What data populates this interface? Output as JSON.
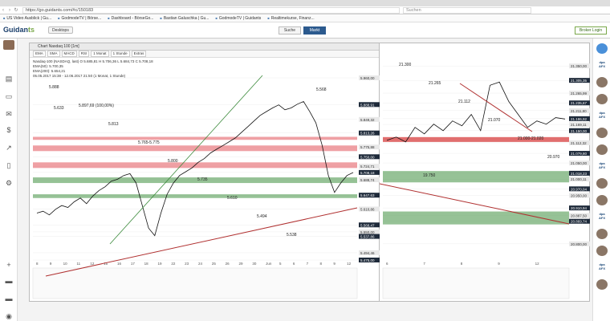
{
  "browser": {
    "url": "https://go.guidants.com/#c/150183",
    "search_placeholder": "Suchen",
    "bookmarks": [
      "US Video Ausblick | Gu...",
      "GodmodeTV | Börse...",
      "Dashboard - BörseGo...",
      "Bastian Galuschka | Gu...",
      "GodmodeTV | Guidants",
      "Realtimekurse, Finanz..."
    ]
  },
  "header": {
    "logo_a": "Guidan",
    "logo_b": "ts",
    "desktops_label": "Desktops",
    "suche_label": "Suche",
    "markt_label": "Markt",
    "login_label": "Broker Login"
  },
  "chart_main": {
    "title": "Chart Nasdaq 100 [1m]",
    "toolbar": [
      "EMA",
      "SMA",
      "MACD",
      "RSI",
      "1 Monat",
      "1 Stunde",
      "Extras"
    ],
    "legend": [
      "Nasdaq-100 (NASDAQ, last)  O 5.685,81  H 5.706,36  L 5.684,73  C 5.708,18",
      "EMA(50): 5.700,35",
      "EMA(200): 5.654,21",
      "05.05.2017 15:38 - 12.06.2017 21:50 (1 Monat, 1 Stunde)"
    ]
  },
  "chart_data": [
    {
      "type": "line",
      "title": "Nasdaq 100",
      "xlabel": "",
      "ylabel": "",
      "ylim": [
        5475,
        5975
      ],
      "y_ticks": [
        "5.960,00",
        "5.888,91",
        "5.849,32",
        "5.813,26",
        "5.775,88",
        "5.750,00",
        "5.724,71",
        "5.708,18",
        "5.688,74",
        "5.647,63",
        "5.610,86",
        "5.568,47",
        "5.550,00",
        "5.537,86",
        "5.494,46",
        "5.475,00"
      ],
      "x_ticks": [
        "8",
        "9",
        "10",
        "11",
        "12",
        "15",
        "16",
        "17",
        "18",
        "19",
        "22",
        "23",
        "24",
        "25",
        "26",
        "29",
        "30",
        "Jun",
        "5",
        "6",
        "7",
        "8",
        "9",
        "12"
      ],
      "annotations": [
        "5.888",
        "5.897,69 (100,00%)",
        "5.813",
        "5.765-5.775",
        "5.800",
        "5.735",
        "5.610",
        "5.494",
        "5.538",
        "5.568",
        "5.633"
      ],
      "series": [
        {
          "values": [
            5600,
            5605,
            5595,
            5610,
            5620,
            5615,
            5630,
            5640,
            5625,
            5645,
            5660,
            5670,
            5685,
            5690,
            5700,
            5705,
            5680,
            5620,
            5560,
            5540,
            5600,
            5650,
            5680,
            5700,
            5710,
            5720,
            5735,
            5745,
            5760,
            5770,
            5780,
            5790,
            5800,
            5815,
            5830,
            5845,
            5860,
            5870,
            5880,
            5888,
            5875,
            5880,
            5890,
            5897,
            5870,
            5840,
            5780,
            5700,
            5655,
            5680,
            5700,
            5708
          ]
        }
      ]
    },
    {
      "type": "line",
      "title": "",
      "ylim": [
        20750,
        21400
      ],
      "y_ticks": [
        "21.350,00",
        "21.305,35",
        "21.265,99",
        "21.235,67",
        "21.211,80",
        "21.186,92",
        "21.169,11",
        "21.150,00",
        "21.112,32",
        "21.079,80",
        "21.050,00",
        "21.018,23",
        "21.000,11",
        "20.970,04",
        "20.950,00",
        "20.910,94",
        "20.887,50",
        "20.869,74",
        "20.800,00"
      ],
      "x_ticks": [
        "6",
        "7",
        "8",
        "9",
        "12"
      ],
      "annotations": [
        "21.300",
        "21.265",
        "21.112",
        "21.070",
        "21.000-21.020",
        "20.970",
        "19.750"
      ],
      "series": [
        {
          "values": [
            21120,
            21130,
            21115,
            21160,
            21140,
            21170,
            21150,
            21180,
            21165,
            21200,
            21150,
            21290,
            21300,
            21240,
            21200,
            21160,
            21180,
            21170,
            21190,
            21186
          ]
        }
      ]
    }
  ]
}
